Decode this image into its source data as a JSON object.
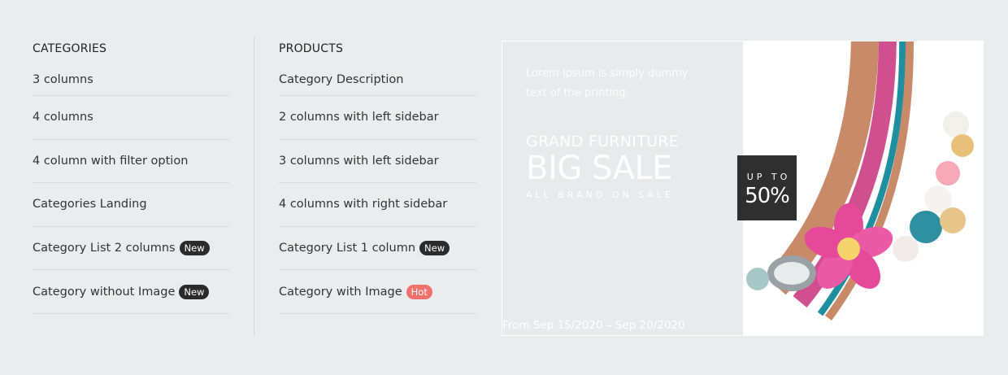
{
  "categories": {
    "title": "CATEGORIES",
    "items": [
      {
        "label": "3 columns",
        "badge": ""
      },
      {
        "label": "4 columns",
        "badge": ""
      },
      {
        "label": "4 column with filter option",
        "badge": ""
      },
      {
        "label": "Categories Landing",
        "badge": ""
      },
      {
        "label": "Category List 2 columns",
        "badge": "New"
      },
      {
        "label": "Category without Image",
        "badge": "New"
      }
    ]
  },
  "products": {
    "title": "PRODUCTS",
    "items": [
      {
        "label": "Category Description",
        "badge": ""
      },
      {
        "label": "2 columns with left sidebar",
        "badge": ""
      },
      {
        "label": "3 columns with left sidebar",
        "badge": ""
      },
      {
        "label": "4 columns with right sidebar",
        "badge": ""
      },
      {
        "label": "Category List 1 column",
        "badge": "New"
      },
      {
        "label": "Category with Image",
        "badge": "Hot"
      }
    ]
  },
  "banner": {
    "lorem": "Lorem Ipsum is simply dummy text of the printing.",
    "subtitle": "GRAND FURNITURE",
    "headline": "BIG SALE",
    "tagline": "ALL BRAND ON SALE",
    "dates": "From Sep 15/2020 – Sep 20/2020",
    "discount_label": "UP TO",
    "discount_value": "50%"
  },
  "colors": {
    "badge_new": "#2b2b2b",
    "badge_hot": "#f0706a",
    "background": "#ebecee"
  }
}
